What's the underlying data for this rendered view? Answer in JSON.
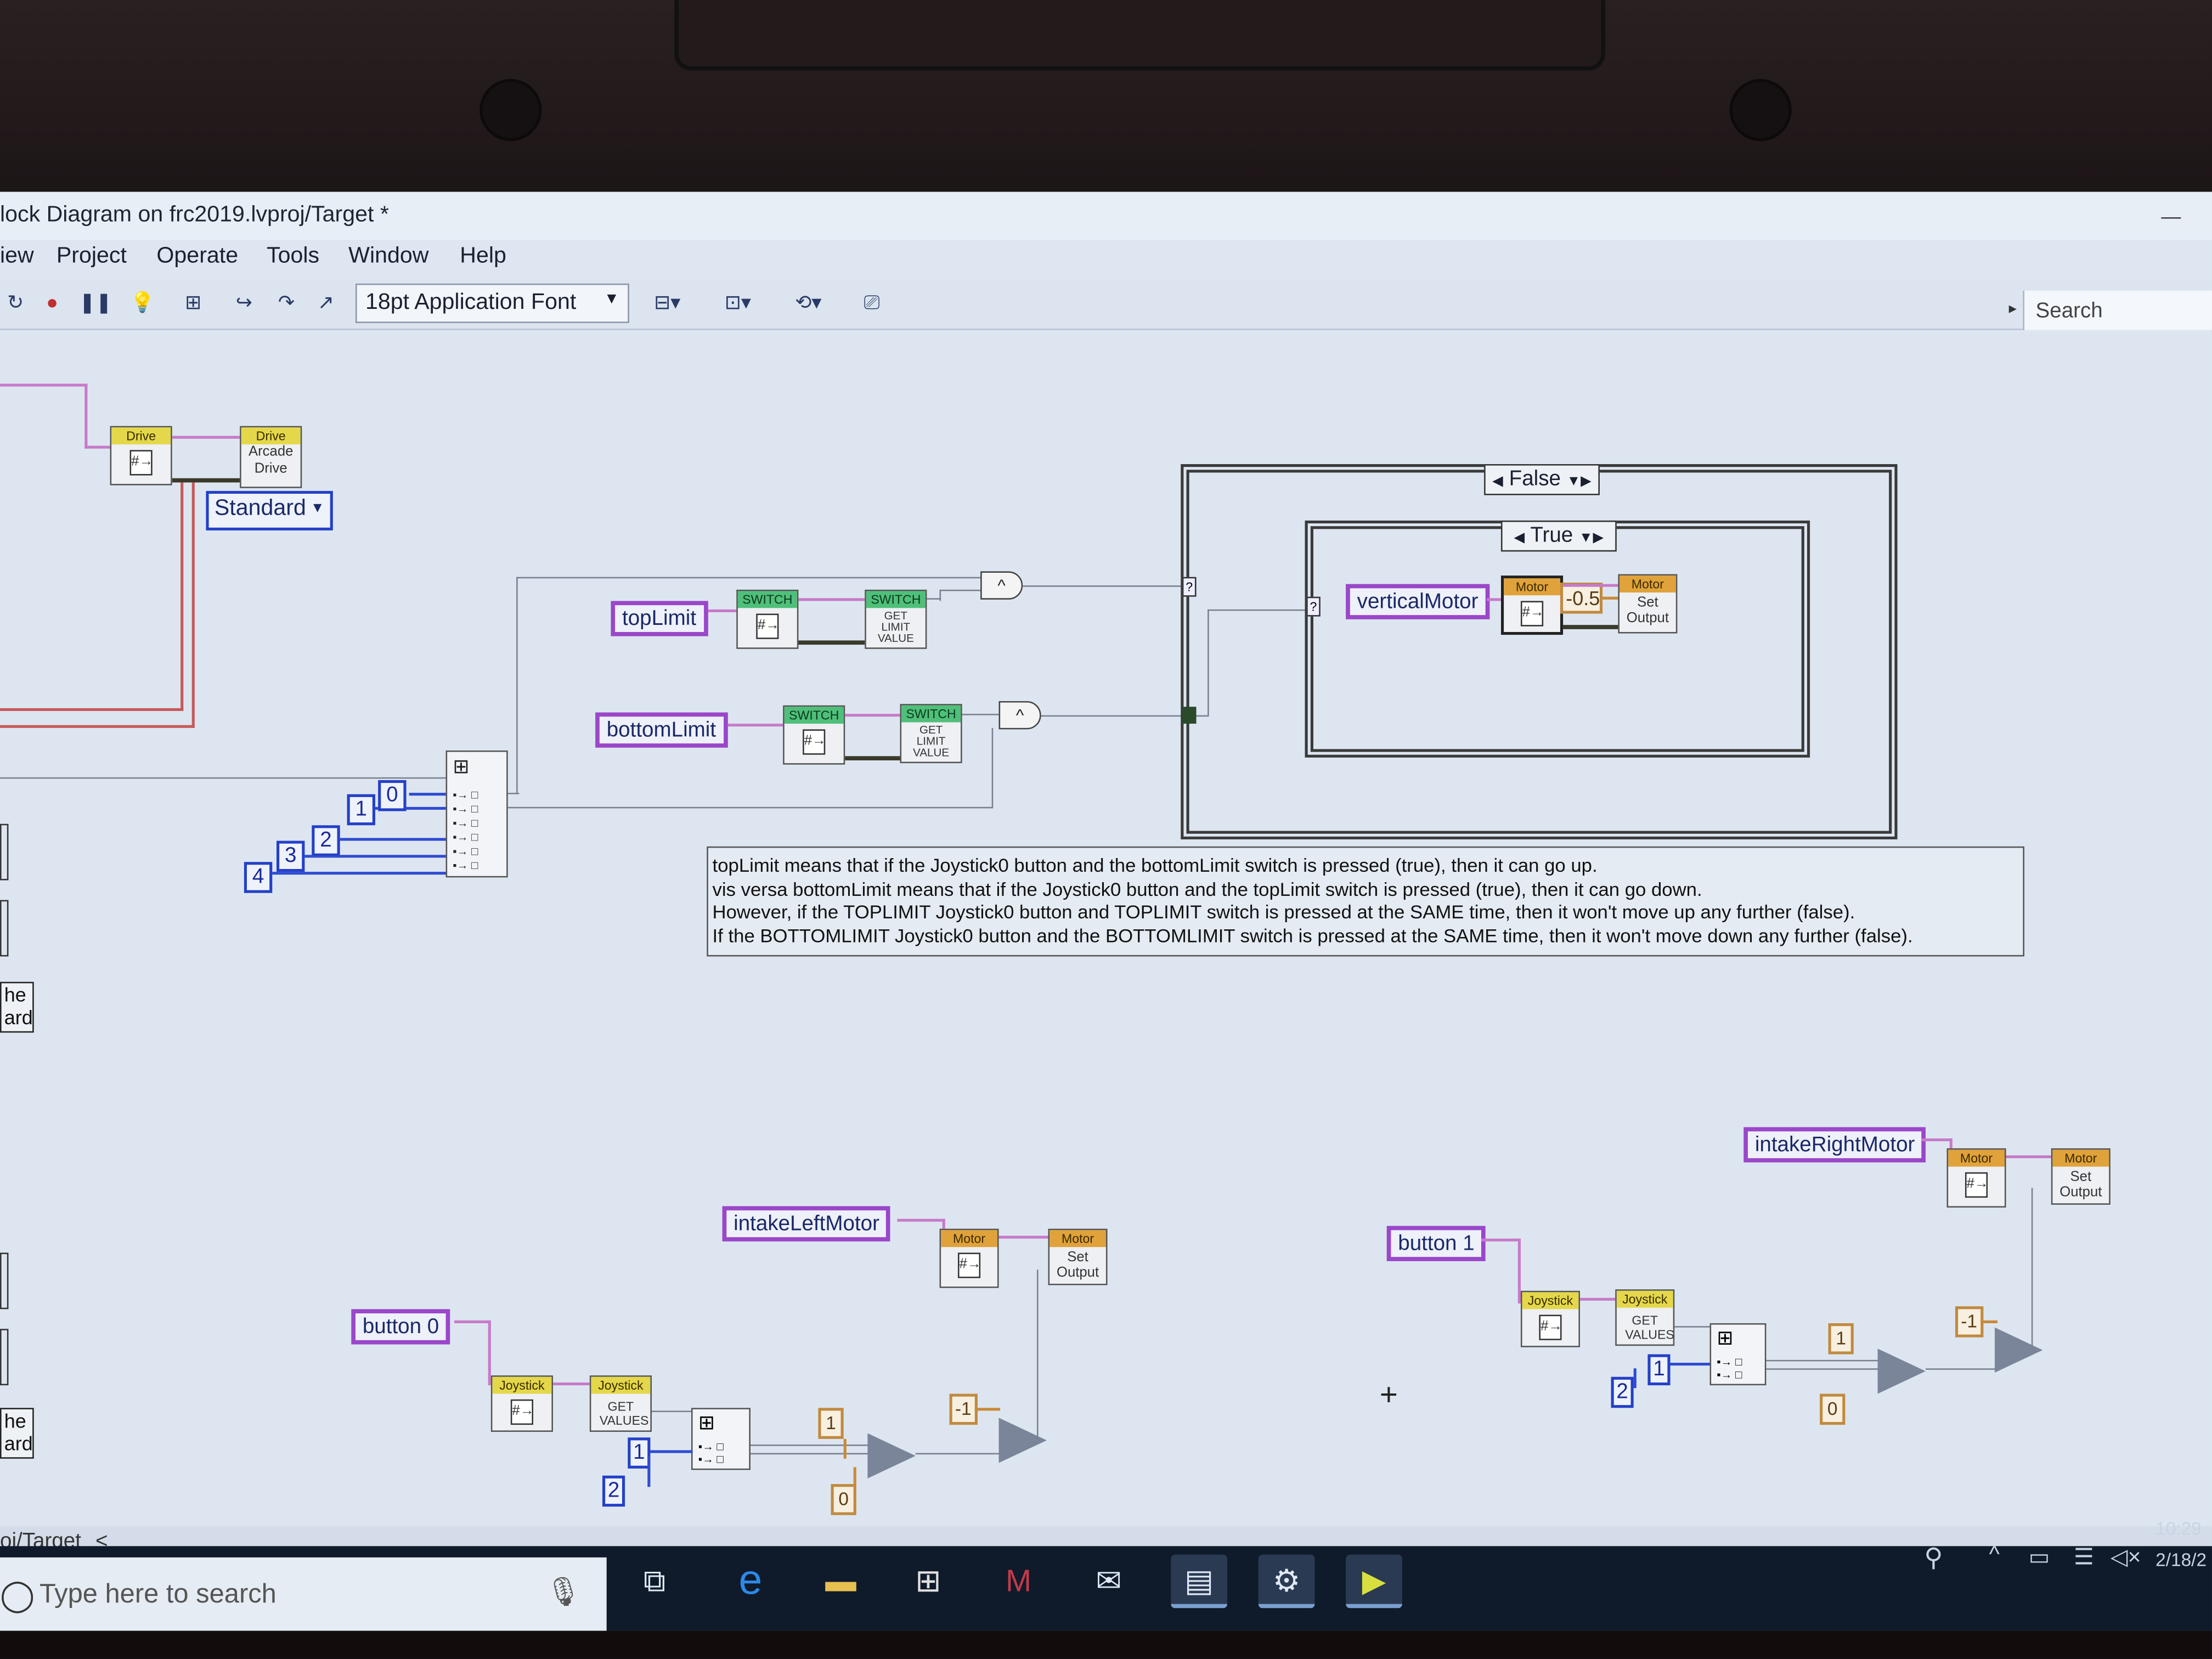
{
  "window": {
    "title": "lock Diagram on frc2019.lvproj/Target *",
    "menu": [
      "iew",
      "Project",
      "Operate",
      "Tools",
      "Window",
      "Help"
    ],
    "font_select": "18pt Application Font",
    "search_label": "Search"
  },
  "diagram": {
    "drive_vi1_head": "Drive",
    "drive_vi2_head": "Drive",
    "drive_vi2_body": "Arcade Drive",
    "standard_enum": "Standard",
    "topLimit": "topLimit",
    "bottomLimit": "bottomLimit",
    "switch1_head": "SWITCH",
    "switch2_head": "SWITCH",
    "switch_get1_head": "SWITCH",
    "switch_get1_body": "GET LIMIT VALUE",
    "switch_get2_head": "SWITCH",
    "switch_get2_body": "GET LIMIT VALUE",
    "and1": "^",
    "and2": "^",
    "index_consts": [
      "0",
      "1",
      "2",
      "3",
      "4"
    ],
    "case_outer": "False",
    "case_inner": "True",
    "verticalMotor": "verticalMotor",
    "motor_head": "Motor",
    "motor_set_head": "Motor",
    "motor_set_body": "Set Output",
    "neg_half": "-0.5",
    "comment": [
      "topLimit means that if the Joystick0 button and the bottomLimit switch is pressed (true), then it can go up.",
      "vis versa bottomLimit means that if the Joystick0 button and the topLimit switch is pressed (true), then it can go down.",
      "However, if the TOPLIMIT Joystick0 button and TOPLIMIT switch is pressed at the SAME time, then it won't move up any further (false).",
      "If the BOTTOMLIMIT Joystick0 button and the BOTTOMLIMIT switch is pressed at the SAME time, then it won't move down any further (false)."
    ],
    "left_labels": [
      "he",
      "ard",
      "he",
      "ard"
    ],
    "intakeLeftMotor": "intakeLeftMotor",
    "intakeRightMotor": "intakeRightMotor",
    "button0": "button 0",
    "button1": "button 1",
    "joystick_head": "Joystick",
    "joystick_get_body": "GET VALUES",
    "left_consts": {
      "one": "1",
      "two": "2",
      "one_o": "1",
      "zero_o": "0",
      "neg1": "-1"
    },
    "right_consts": {
      "one": "1",
      "two": "2",
      "one_o": "1",
      "zero_o": "0",
      "neg1": "-1"
    }
  },
  "status": {
    "target": "oj/Target"
  },
  "taskbar": {
    "search_placeholder": "Type here to search",
    "time": "10:29",
    "date": "2/18/2"
  },
  "colors": {
    "control_border": "#9a47c9",
    "numeric_blue": "#2440c8",
    "vi_yellow": "#e4d84a",
    "vi_green": "#4fbf7a",
    "vi_orange": "#e0a23a"
  }
}
